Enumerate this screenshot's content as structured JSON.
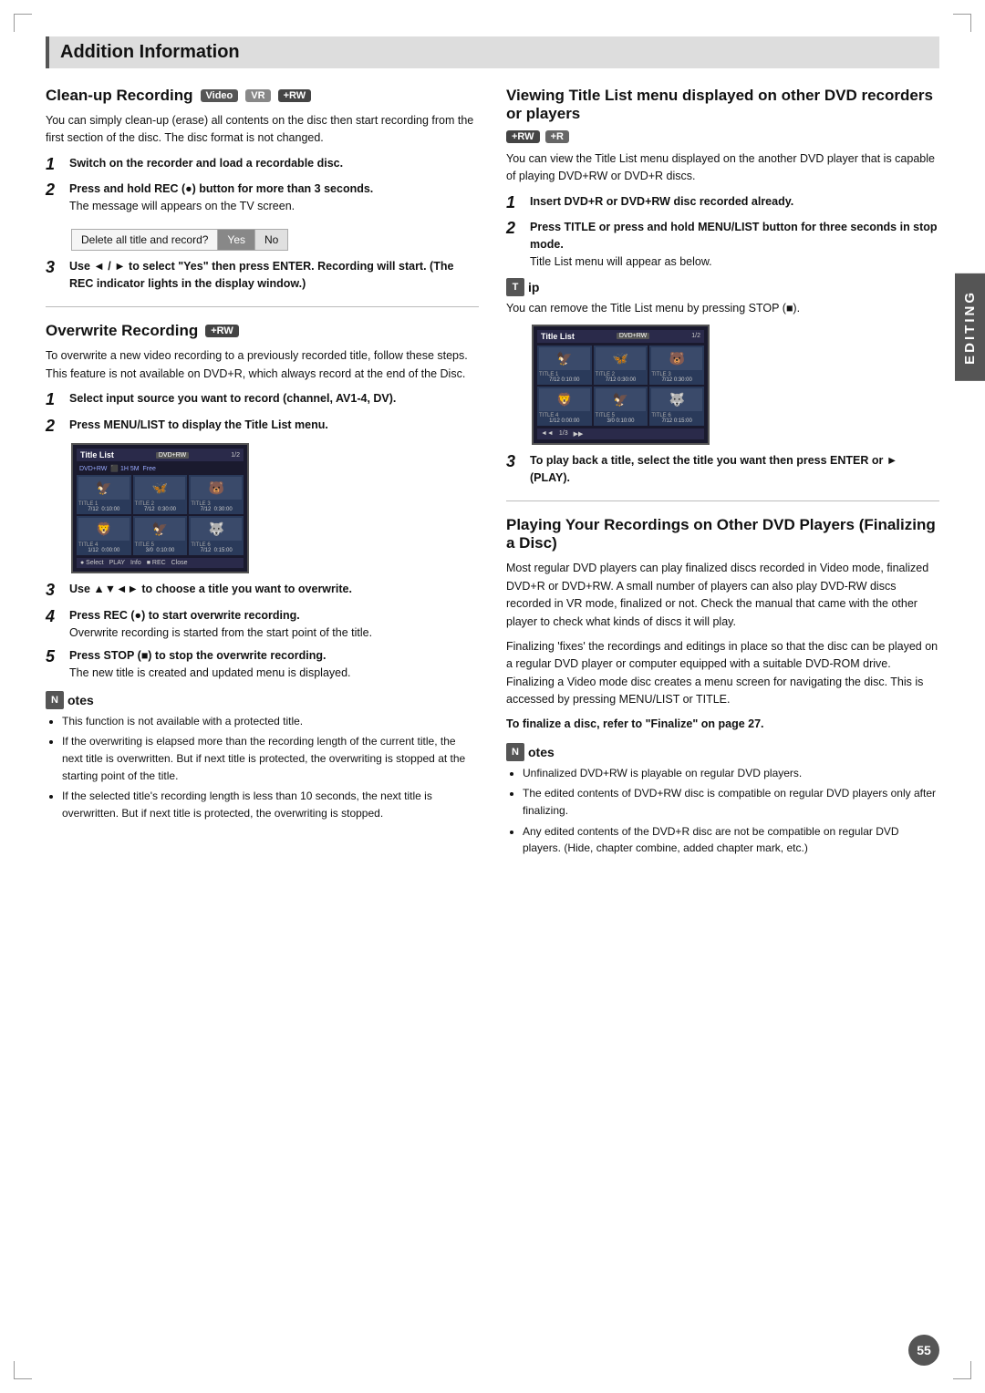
{
  "page": {
    "section_header": "Addition Information",
    "page_number": "55",
    "editing_tab": "EDITING"
  },
  "cleanup": {
    "title": "Clean-up Recording",
    "badges": [
      "Video",
      "VR",
      "+RW"
    ],
    "intro": "You can simply clean-up (erase) all contents on the disc then start recording from the first section of the disc. The disc format is not changed.",
    "steps": [
      {
        "number": "1",
        "text": "Switch on the recorder and load a recordable disc."
      },
      {
        "number": "2",
        "text": "Press and hold REC (●) button for more than 3 seconds.",
        "sub": "The message will appears on the TV screen."
      },
      {
        "number": "3",
        "text": "Use ◄ / ► to select \"Yes\" then press ENTER. Recording will start. (The REC indicator lights in the display window.)"
      }
    ],
    "dialog": {
      "question": "Delete all title and record?",
      "buttons": [
        "Yes",
        "No"
      ]
    }
  },
  "overwrite": {
    "title": "Overwrite Recording",
    "badge": "+RW",
    "intro": "To overwrite a new video recording to a previously recorded title, follow these steps. This feature is not available on DVD+R, which always record at the end of the Disc.",
    "steps": [
      {
        "number": "1",
        "text": "Select input source you want to record (channel, AV1-4, DV)."
      },
      {
        "number": "2",
        "text": "Press MENU/LIST to display the Title List menu."
      },
      {
        "number": "3",
        "text": "Use ▲▼◄► to choose a title you want to overwrite."
      },
      {
        "number": "4",
        "text": "Press REC (●) to start overwrite recording.",
        "sub": "Overwrite recording is started from the start point of the title."
      },
      {
        "number": "5",
        "text": "Press STOP (■) to stop the overwrite recording.",
        "sub": "The new title is created and updated menu is displayed."
      }
    ],
    "notes_header": "otes",
    "notes": [
      "This function is not available with a protected title.",
      "If the overwriting is elapsed more than the recording length of the current title, the next title is overwritten. But if next title is protected, the overwriting is stopped at the starting point of the title.",
      "If the selected title's recording length is less than 10 seconds, the next title is overwritten. But if next title is protected, the overwriting is stopped."
    ],
    "screen": {
      "label": "Title List",
      "badge": "DVD+RW",
      "page": "1/2",
      "info_lines": [
        "DVD+RW",
        "1H 5M",
        "Free"
      ],
      "cells": [
        {
          "emoji": "🦅",
          "title": "TITLE 1",
          "ch": "7/12",
          "time": "0:10:00"
        },
        {
          "emoji": "🦋",
          "title": "TITLE 2",
          "ch": "7/12",
          "time": "0:30:00"
        },
        {
          "emoji": "🐻",
          "title": "TITLE 3",
          "ch": "7/12",
          "time": "0:30:00"
        },
        {
          "emoji": "🦁",
          "title": "TITLE 4",
          "ch": "1/12",
          "time": "0:00:00"
        },
        {
          "emoji": "🦅",
          "title": "TITLE 5",
          "ch": "3/0",
          "time": "0:10:00"
        },
        {
          "emoji": "🐺",
          "title": "TITLE 6",
          "ch": "7/12",
          "time": "0:15:00"
        }
      ],
      "footer_items": [
        "● Select",
        "PLAY",
        "Info",
        "■ REC",
        "Close"
      ]
    }
  },
  "viewing": {
    "title": "Viewing Title List menu displayed on other DVD recorders or players",
    "badges": [
      "+RW",
      "+R"
    ],
    "intro": "You can view the Title List menu displayed on the another DVD player that is capable of playing DVD+RW or DVD+R discs.",
    "steps": [
      {
        "number": "1",
        "text": "Insert DVD+R or DVD+RW disc recorded already."
      },
      {
        "number": "2",
        "text": "Press TITLE or press and hold MENU/LIST button for three seconds in stop mode.",
        "sub": "Title List menu will appear as below."
      },
      {
        "number": "3",
        "text": "To play back a title, select the title you want then press ENTER or ► (PLAY)."
      }
    ],
    "tip": {
      "header": "ip",
      "text": "You can remove the Title List menu by pressing STOP (■)."
    },
    "screen": {
      "label": "Title List",
      "badge": "DVD+RW",
      "page": "1/2",
      "cells": [
        {
          "emoji": "🦅",
          "title": "TITLE 1",
          "ch": "7/12",
          "time": "0:10:00"
        },
        {
          "emoji": "🦋",
          "title": "TITLE 2",
          "ch": "7/12",
          "time": "0:30:00"
        },
        {
          "emoji": "🐻",
          "title": "TITLE 3",
          "ch": "7/12",
          "time": "0:30:00"
        },
        {
          "emoji": "🦁",
          "title": "TITLE 4",
          "ch": "1/12",
          "time": "0:00:00"
        },
        {
          "emoji": "🦅",
          "title": "TITLE 5",
          "ch": "3/0",
          "time": "0:10:00"
        },
        {
          "emoji": "🐺",
          "title": "TITLE 6",
          "ch": "7/12",
          "time": "0:15:00"
        }
      ],
      "footer_items": [
        "◄◄",
        "1/3",
        "▶▶"
      ]
    }
  },
  "playing": {
    "title": "Playing Your Recordings on Other DVD Players (Finalizing a Disc)",
    "intro1": "Most regular DVD players can play finalized discs recorded in Video mode, finalized DVD+R or DVD+RW. A small number of players can also play DVD-RW discs recorded in VR mode, finalized or not. Check the manual that came with the other player to check what kinds of discs it will play.",
    "intro2": "Finalizing 'fixes' the recordings and editings in place so that the disc can be played on a regular DVD player or computer equipped with a suitable DVD-ROM drive. Finalizing a Video mode disc creates a menu screen for navigating the disc. This is accessed by pressing MENU/LIST or TITLE.",
    "finalize_note": "To finalize a disc, refer to \"Finalize\" on page 27.",
    "notes_header": "otes",
    "notes": [
      "Unfinalized DVD+RW is playable on regular DVD players.",
      "The edited contents of DVD+RW disc is compatible on regular DVD players only after finalizing.",
      "Any edited contents of the DVD+R disc are not be compatible on regular DVD players. (Hide, chapter combine, added chapter mark, etc.)"
    ]
  }
}
